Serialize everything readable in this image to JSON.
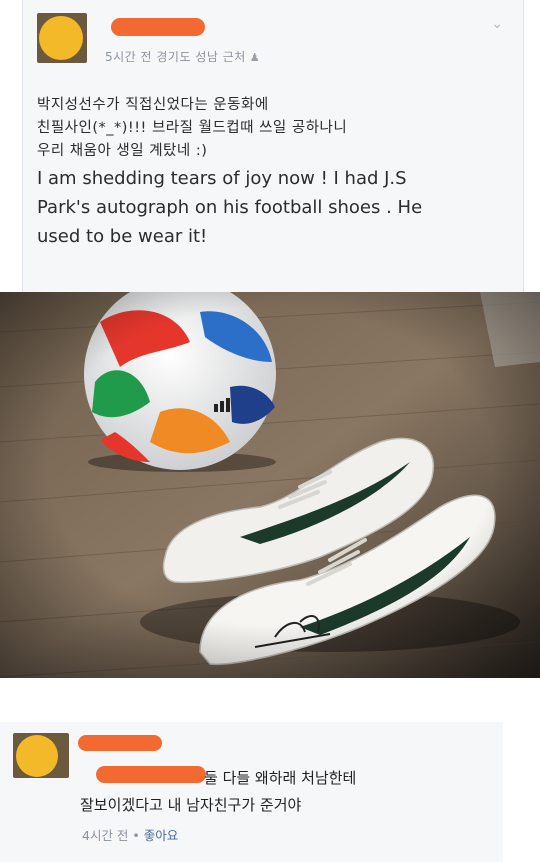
{
  "post": {
    "meta": "5시간 전 경기도 성남 근처",
    "menu_icon": "chevron-down-icon",
    "text_ko_line1": "박지성선수가 직접신었다는 운동화에",
    "text_ko_line2": "친필사인(*_*)!!! 브라질 월드컵때 쓰일 공하나니",
    "text_ko_line3": "우리 채움아 생일 계탔네 :)",
    "text_en_line1": "I am shedding tears of joy now ! I had J.S",
    "text_en_line2": "Park's autograph on his football shoes . He",
    "text_en_line3": "used to be wear it!"
  },
  "comment": {
    "text_line1": "둘 다들 왜하래 처남한테",
    "text_line2": "잘보이겠다고 내 남자친구가 준거야",
    "time": "4시간 전",
    "separator": "•",
    "like": "좋아요"
  },
  "colors": {
    "redaction": "#f26a32",
    "avatar": "#f4b928",
    "background": "#f6f7f9",
    "meta_text": "#8d949e",
    "link": "#4b67a1"
  }
}
